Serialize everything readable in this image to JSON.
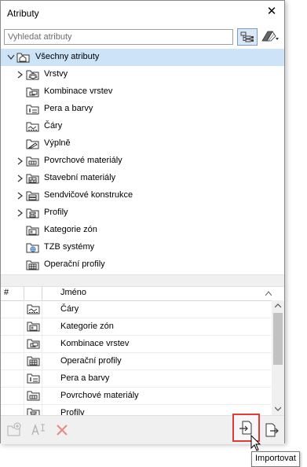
{
  "window": {
    "title": "Atributy"
  },
  "search": {
    "placeholder": "Vyhledat atributy"
  },
  "tree": {
    "root": "Všechny atributy",
    "items": [
      {
        "label": "Vrstvy",
        "expandable": true,
        "icon": "layers-icon"
      },
      {
        "label": "Kombinace vrstev",
        "expandable": false,
        "icon": "layer-combination-icon"
      },
      {
        "label": "Pera a barvy",
        "expandable": false,
        "icon": "pens-colors-icon"
      },
      {
        "label": "Čáry",
        "expandable": false,
        "icon": "line-types-icon"
      },
      {
        "label": "Výplně",
        "expandable": false,
        "icon": "fills-icon"
      },
      {
        "label": "Povrchové materiály",
        "expandable": true,
        "icon": "surface-materials-icon"
      },
      {
        "label": "Stavební materiály",
        "expandable": true,
        "icon": "building-materials-icon"
      },
      {
        "label": "Sendvičové konstrukce",
        "expandable": true,
        "icon": "composites-icon"
      },
      {
        "label": "Profily",
        "expandable": true,
        "icon": "profiles-icon"
      },
      {
        "label": "Kategorie zón",
        "expandable": false,
        "icon": "zone-categories-icon"
      },
      {
        "label": "TZB systémy",
        "expandable": false,
        "icon": "mep-systems-icon"
      },
      {
        "label": "Operační profily",
        "expandable": false,
        "icon": "operation-profiles-icon"
      }
    ]
  },
  "list": {
    "columns": {
      "number": "#",
      "name": "Jméno"
    },
    "rows": [
      {
        "name": "Čáry",
        "icon": "line-types-icon"
      },
      {
        "name": "Kategorie zón",
        "icon": "zone-categories-icon"
      },
      {
        "name": "Kombinace vrstev",
        "icon": "layer-combination-icon"
      },
      {
        "name": "Operační profily",
        "icon": "operation-profiles-icon"
      },
      {
        "name": "Pera a barvy",
        "icon": "pens-colors-icon"
      },
      {
        "name": "Povrchové materiály",
        "icon": "surface-materials-icon"
      },
      {
        "name": "Profily",
        "icon": "profiles-icon"
      }
    ]
  },
  "footer": {
    "new_icon": "new-attribute-icon",
    "rename_icon": "rename-icon",
    "delete_icon": "delete-icon",
    "import_icon": "import-icon",
    "export_icon": "export-icon"
  },
  "tooltip": {
    "text": "Importovat"
  },
  "colors": {
    "selection": "#cde3f8",
    "highlight_border": "#e53935",
    "delete": "#e88a80"
  }
}
